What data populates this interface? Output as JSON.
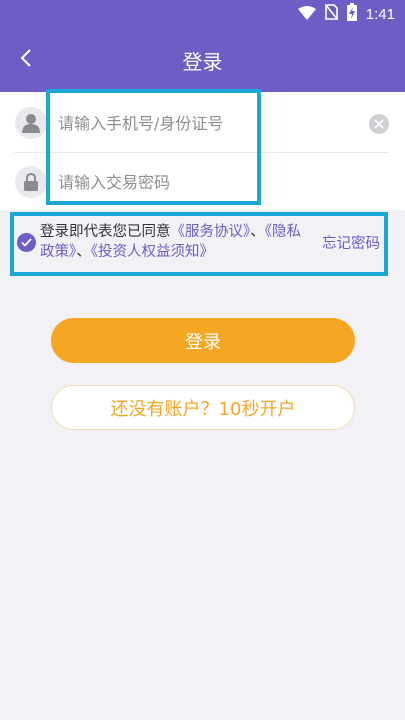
{
  "status_bar": {
    "time": "1:41",
    "icons": [
      "wifi-icon",
      "no-sim-icon",
      "battery-charging-icon"
    ]
  },
  "header": {
    "title": "登录",
    "back_icon": "chevron-left-icon"
  },
  "form": {
    "account": {
      "placeholder": "请输入手机号/身份证号",
      "value": "",
      "icon": "user-icon",
      "clear_icon": "clear-icon"
    },
    "password": {
      "placeholder": "请输入交易密码",
      "value": "",
      "icon": "lock-icon"
    }
  },
  "agreement": {
    "checked": true,
    "prefix": "登录即代表您已同意",
    "service_link": "《服务协议》",
    "separator1": "、",
    "privacy_link": "《隐私政策》",
    "separator2": "、",
    "investor_link": "《投资人权益须知》",
    "forgot_password": "忘记密码"
  },
  "buttons": {
    "login_label": "登录",
    "register_label": "还没有账户？10秒开户"
  },
  "colors": {
    "primary": "#6f5cc4",
    "accent": "#f5a623",
    "highlight": "#1ba6d8",
    "background": "#f2f1f6"
  }
}
